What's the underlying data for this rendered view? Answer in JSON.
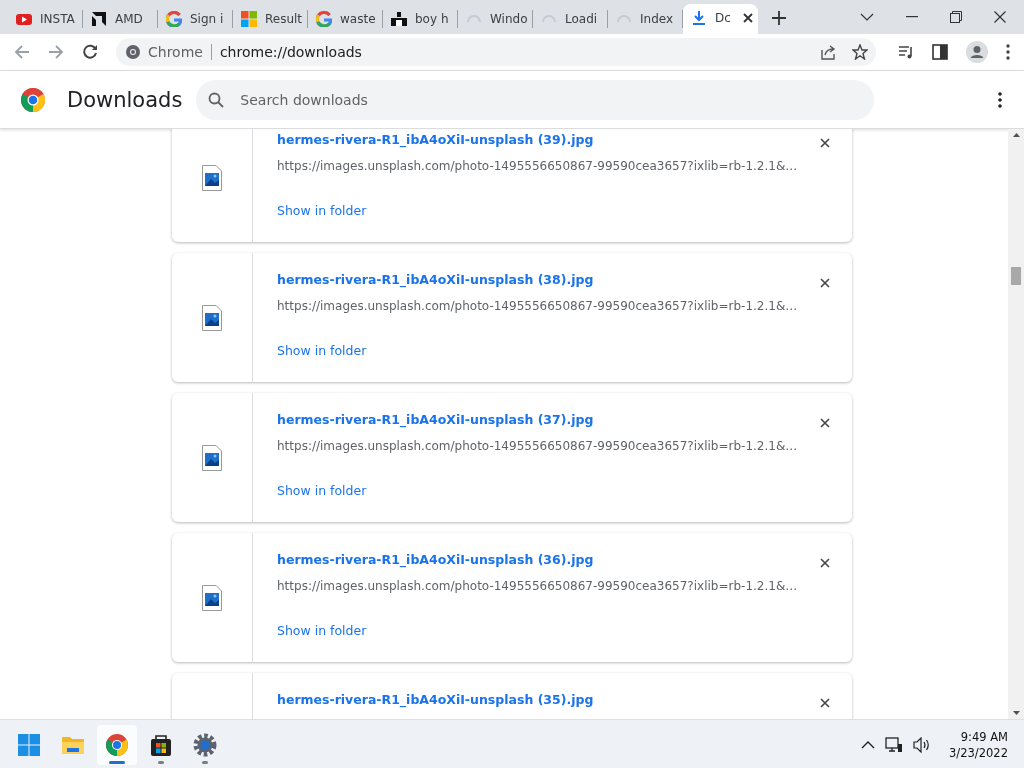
{
  "tabs": [
    {
      "label": "INSTA",
      "kind": "video",
      "selected": false
    },
    {
      "label": "AMD",
      "kind": "amd",
      "selected": false
    },
    {
      "label": "Sign i",
      "kind": "google",
      "selected": false
    },
    {
      "label": "Result",
      "kind": "squares",
      "selected": false
    },
    {
      "label": "waste",
      "kind": "google",
      "selected": false
    },
    {
      "label": "boy h",
      "kind": "blocks",
      "selected": false
    },
    {
      "label": "Windo",
      "kind": "loading",
      "selected": false
    },
    {
      "label": "Loadi",
      "kind": "loading",
      "selected": false
    },
    {
      "label": "Index",
      "kind": "loading",
      "selected": false
    },
    {
      "label": "Dc",
      "kind": "download",
      "selected": true
    }
  ],
  "omnibox": {
    "site": "Chrome",
    "url": "chrome://downloads"
  },
  "page": {
    "title": "Downloads",
    "search": {
      "placeholder": "Search downloads"
    }
  },
  "downloads": [
    {
      "filename": "hermes-rivera-R1_ibA4oXiI-unsplash (39).jpg",
      "url": "https://images.unsplash.com/photo-1495556650867-99590cea3657?ixlib=rb-1.2.1&…",
      "action": "Show in folder"
    },
    {
      "filename": "hermes-rivera-R1_ibA4oXiI-unsplash (38).jpg",
      "url": "https://images.unsplash.com/photo-1495556650867-99590cea3657?ixlib=rb-1.2.1&…",
      "action": "Show in folder"
    },
    {
      "filename": "hermes-rivera-R1_ibA4oXiI-unsplash (37).jpg",
      "url": "https://images.unsplash.com/photo-1495556650867-99590cea3657?ixlib=rb-1.2.1&…",
      "action": "Show in folder"
    },
    {
      "filename": "hermes-rivera-R1_ibA4oXiI-unsplash (36).jpg",
      "url": "https://images.unsplash.com/photo-1495556650867-99590cea3657?ixlib=rb-1.2.1&…",
      "action": "Show in folder"
    },
    {
      "filename": "hermes-rivera-R1_ibA4oXiI-unsplash (35).jpg"
    }
  ],
  "taskbar": {
    "apps": [
      {
        "kind": "start",
        "running": false,
        "active": false
      },
      {
        "kind": "folder",
        "running": false,
        "active": false
      },
      {
        "kind": "browser",
        "running": true,
        "active": true
      },
      {
        "kind": "store",
        "running": true,
        "active": false
      },
      {
        "kind": "settings",
        "running": true,
        "active": false
      }
    ],
    "time": "9:49 AM",
    "date": "3/23/2022"
  }
}
